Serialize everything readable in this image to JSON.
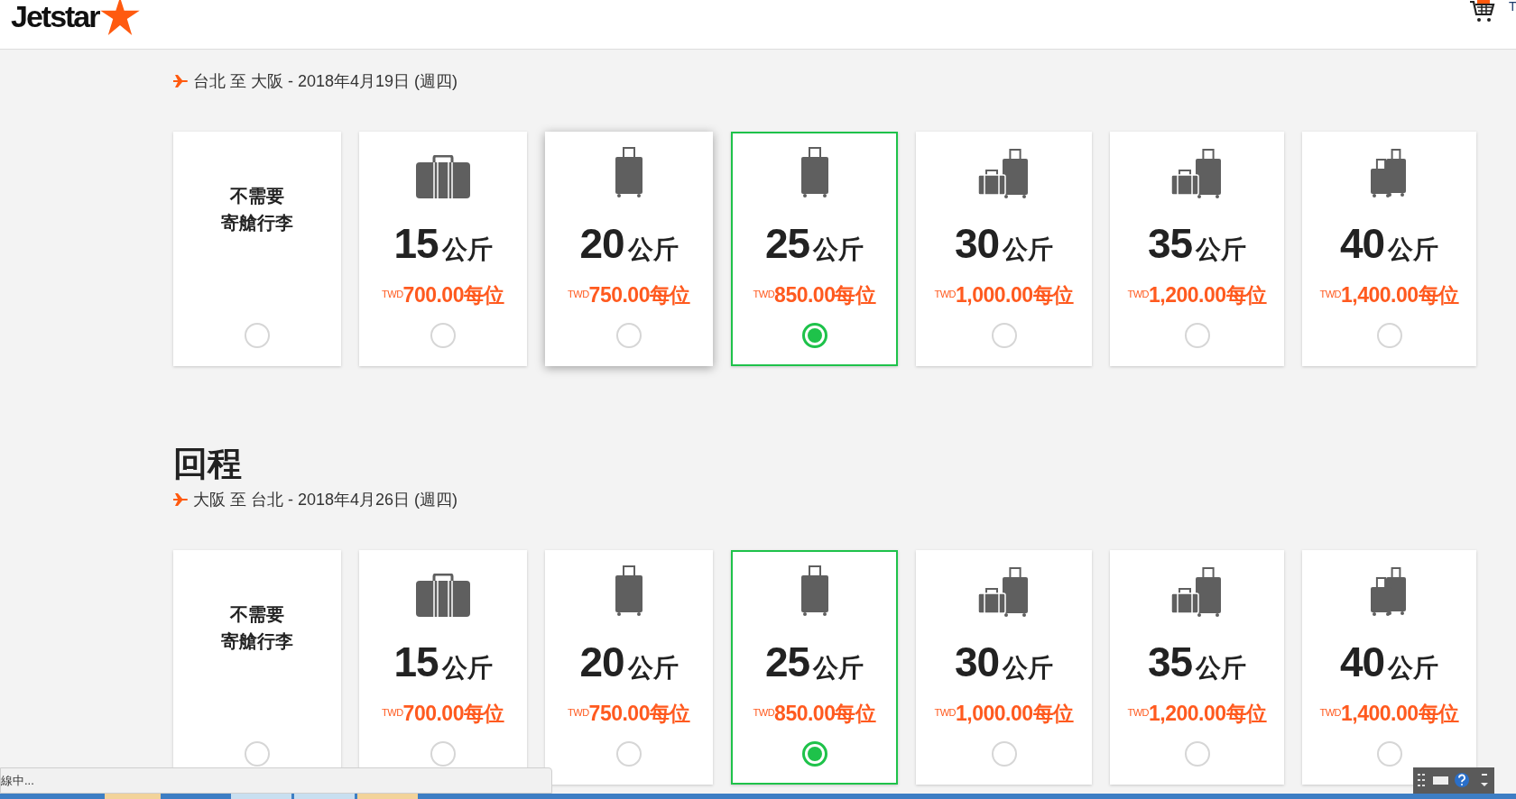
{
  "header": {
    "logo": "Jetstar",
    "edge_text": "T"
  },
  "sections": [
    {
      "route": "台北 至 大阪 - 2018年4月19日 (週四)",
      "options": [
        {
          "kind": "none",
          "label_lines": [
            "不需要",
            "寄艙行李"
          ],
          "selected": false,
          "hovered": false
        },
        {
          "kind": "suitcase",
          "weight": "15",
          "unit": "公斤",
          "price": "$^{TWD}$700.00每位",
          "selected": false,
          "hovered": false
        },
        {
          "kind": "trolley",
          "weight": "20",
          "unit": "公斤",
          "price": "$^{TWD}$750.00每位",
          "selected": false,
          "hovered": true
        },
        {
          "kind": "trolley",
          "weight": "25",
          "unit": "公斤",
          "price": "$^{TWD}$850.00每位",
          "selected": true,
          "hovered": false
        },
        {
          "kind": "pair",
          "weight": "30",
          "unit": "公斤",
          "price": "$^{TWD}$1,000.00每位",
          "selected": false,
          "hovered": false
        },
        {
          "kind": "pair",
          "weight": "35",
          "unit": "公斤",
          "price": "$^{TWD}$1,200.00每位",
          "selected": false,
          "hovered": false
        },
        {
          "kind": "twin",
          "weight": "40",
          "unit": "公斤",
          "price": "$^{TWD}$1,400.00每位",
          "selected": false,
          "hovered": false
        }
      ]
    },
    {
      "title": "回程",
      "route": "大阪 至 台北 - 2018年4月26日 (週四)",
      "options": [
        {
          "kind": "none",
          "label_lines": [
            "不需要",
            "寄艙行李"
          ],
          "selected": false,
          "hovered": false
        },
        {
          "kind": "suitcase",
          "weight": "15",
          "unit": "公斤",
          "price": "$^{TWD}$700.00每位",
          "selected": false,
          "hovered": false
        },
        {
          "kind": "trolley",
          "weight": "20",
          "unit": "公斤",
          "price": "$^{TWD}$750.00每位",
          "selected": false,
          "hovered": false
        },
        {
          "kind": "trolley",
          "weight": "25",
          "unit": "公斤",
          "price": "$^{TWD}$850.00每位",
          "selected": true,
          "hovered": false
        },
        {
          "kind": "pair",
          "weight": "30",
          "unit": "公斤",
          "price": "$^{TWD}$1,000.00每位",
          "selected": false,
          "hovered": false
        },
        {
          "kind": "pair",
          "weight": "35",
          "unit": "公斤",
          "price": "$^{TWD}$1,200.00每位",
          "selected": false,
          "hovered": false
        },
        {
          "kind": "twin",
          "weight": "40",
          "unit": "公斤",
          "price": "$^{TWD}$1,400.00每位",
          "selected": false,
          "hovered": false
        }
      ]
    }
  ],
  "status_bar": "線中..."
}
